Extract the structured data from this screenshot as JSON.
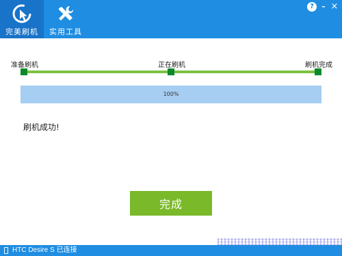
{
  "tabs": [
    {
      "label": "完美刷机",
      "icon": "refresh-cursor-icon",
      "active": true
    },
    {
      "label": "实用工具",
      "icon": "tools-icon",
      "active": false
    }
  ],
  "window_controls": {
    "help": "?",
    "minimize": "–",
    "close": "×"
  },
  "steps": [
    {
      "label": "准备刷机"
    },
    {
      "label": "正在刷机"
    },
    {
      "label": "刷机完成"
    }
  ],
  "progress": {
    "value": 1.0,
    "text": "100%"
  },
  "result": {
    "message": "刷机成功!"
  },
  "done_button": {
    "label": "完成"
  },
  "status": {
    "device": "HTC Desire S 已连接",
    "icon": "phone-icon"
  },
  "colors": {
    "header": "#1e8de2",
    "active_tab": "#1873c9",
    "step_line": "#7dc142",
    "step_node": "#0b8a2c",
    "progress": "#a6cdf2",
    "button": "#7ab929"
  }
}
